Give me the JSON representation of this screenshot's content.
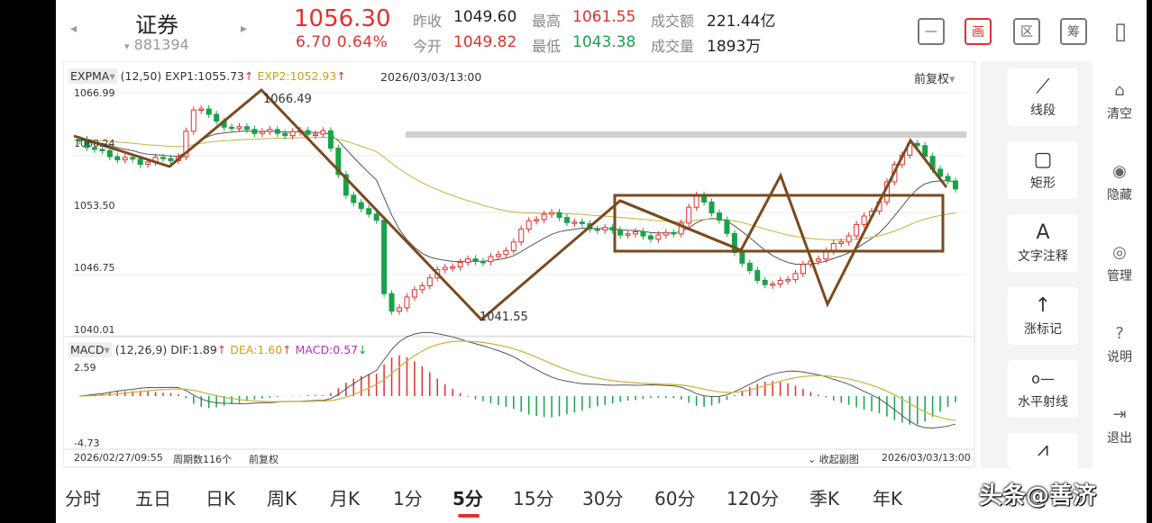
{
  "header": {
    "name": "证券",
    "code": "881394",
    "price": "1056.30",
    "change": "6.70  0.64%",
    "prev_close_label": "昨收",
    "prev_close": "1049.60",
    "high_label": "最高",
    "high": "1061.55",
    "amount_label": "成交额",
    "amount": "221.44亿",
    "open_label": "今开",
    "open": "1049.82",
    "low_label": "最低",
    "low": "1043.38",
    "volume_label": "成交量",
    "volume": "1893万",
    "icons": [
      {
        "name": "minus-icon",
        "glyph": "—"
      },
      {
        "name": "drawing-icon",
        "glyph": "画"
      },
      {
        "name": "range-icon",
        "glyph": "区"
      },
      {
        "name": "chips-icon",
        "glyph": "筹"
      },
      {
        "name": "device-icon",
        "glyph": "▯"
      }
    ]
  },
  "main_chart": {
    "indicator": "EXPMA",
    "params": "(12,50)",
    "exp1": "EXP1:1055.73",
    "exp2": "EXP2:1052.93",
    "cursor_time": "2026/03/03/13:00",
    "adjust": "前复权",
    "y_ticks": [
      "1066.99",
      "1060.24",
      "1053.50",
      "1046.75",
      "1040.01"
    ],
    "high_label": "1066.49",
    "low_label": "1041.55"
  },
  "sub_chart": {
    "indicator": "MACD",
    "params": "(12,26,9)",
    "dif": "DIF:1.89",
    "dea": "DEA:1.60",
    "macd": "MACD:0.57",
    "y_top": "2.59",
    "y_bottom": "-4.73",
    "collapse_label": "收起副图"
  },
  "footer_axis": {
    "start_time": "2026/02/27/09:55",
    "period_count": "周期数116个",
    "adjust": "前复权",
    "end_time": "2026/03/03/13:00"
  },
  "tools": [
    {
      "name": "line-segment",
      "label": "线段",
      "glyph": "⟋"
    },
    {
      "name": "rectangle",
      "label": "矩形",
      "glyph": "▢"
    },
    {
      "name": "text-note",
      "label": "文字注释",
      "glyph": "A"
    },
    {
      "name": "rise-mark",
      "label": "涨标记",
      "glyph": "↑"
    },
    {
      "name": "horizontal-ray",
      "label": "水平射线",
      "glyph": "o—"
    },
    {
      "name": "wave",
      "label": "",
      "glyph": "⩘"
    }
  ],
  "side_actions": [
    {
      "name": "clear",
      "label": "清空",
      "glyph": "⌂"
    },
    {
      "name": "hide",
      "label": "隐藏",
      "glyph": "◉"
    },
    {
      "name": "manage",
      "label": "管理",
      "glyph": "◎"
    },
    {
      "name": "help",
      "label": "说明",
      "glyph": "?"
    },
    {
      "name": "exit",
      "label": "退出",
      "glyph": "⇥"
    }
  ],
  "periods": [
    "分时",
    "五日",
    "日K",
    "周K",
    "月K",
    "1分",
    "5分",
    "15分",
    "30分",
    "60分",
    "120分",
    "季K",
    "年K"
  ],
  "active_period": "5分",
  "watermark": "头条@善济",
  "colors": {
    "up": "#e0312e",
    "down": "#17a34a",
    "exp1": "#555555",
    "exp2": "#c8b23a",
    "drawing": "#7a4a1e"
  }
}
